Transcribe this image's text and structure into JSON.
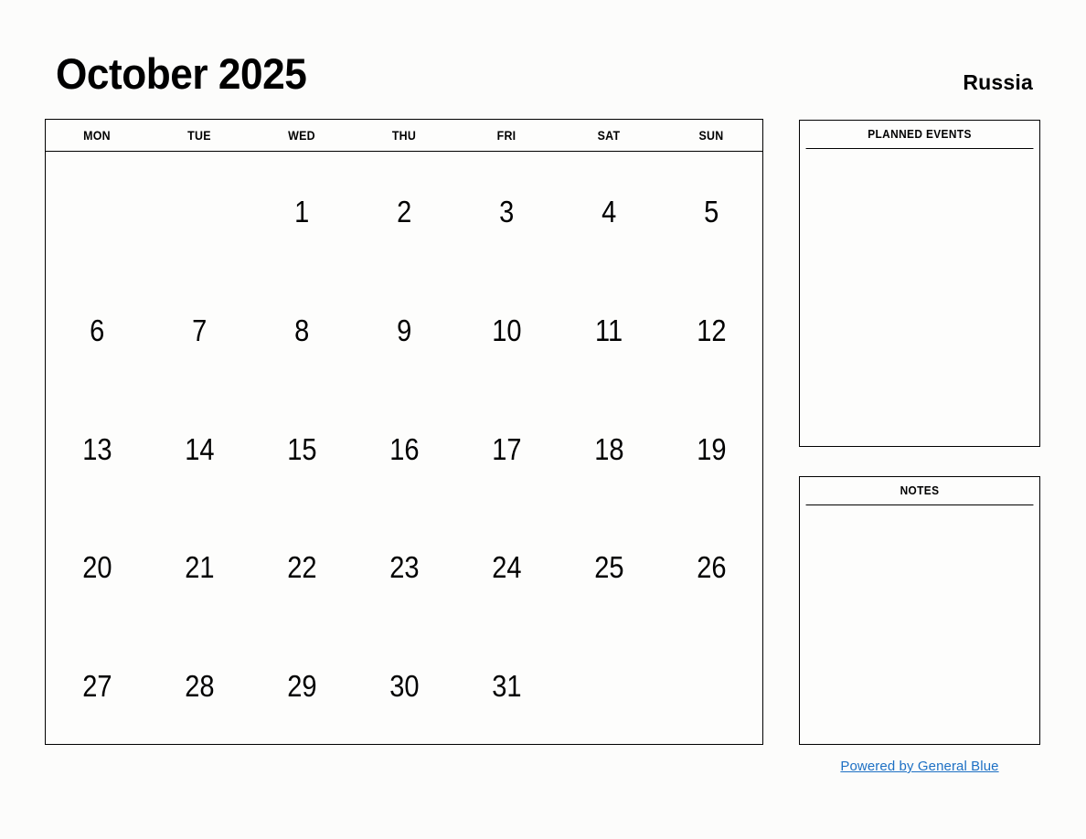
{
  "header": {
    "month_title": "October 2025",
    "country": "Russia"
  },
  "calendar": {
    "weekdays": [
      "MON",
      "TUE",
      "WED",
      "THU",
      "FRI",
      "SAT",
      "SUN"
    ],
    "weeks": [
      [
        "",
        "",
        "1",
        "2",
        "3",
        "4",
        "5"
      ],
      [
        "6",
        "7",
        "8",
        "9",
        "10",
        "11",
        "12"
      ],
      [
        "13",
        "14",
        "15",
        "16",
        "17",
        "18",
        "19"
      ],
      [
        "20",
        "21",
        "22",
        "23",
        "24",
        "25",
        "26"
      ],
      [
        "27",
        "28",
        "29",
        "30",
        "31",
        "",
        ""
      ]
    ]
  },
  "panels": {
    "planned_events": {
      "title": "PLANNED EVENTS",
      "content": ""
    },
    "notes": {
      "title": "NOTES",
      "content": ""
    }
  },
  "footer": {
    "link_text": "Powered by General Blue"
  },
  "colors": {
    "background": "#fcfcfb",
    "border": "#000000",
    "text": "#000000",
    "link": "#1d70c4"
  }
}
